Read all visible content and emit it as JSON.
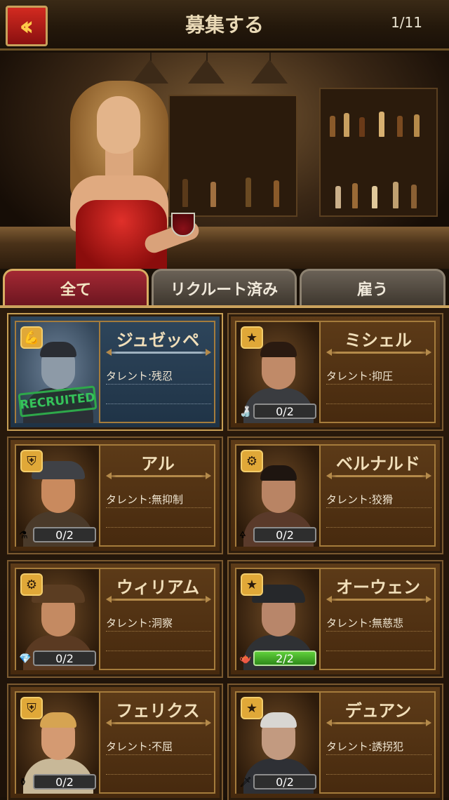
{
  "header": {
    "title": "募集する",
    "page_indicator": "1/11",
    "back_icon": "double-chevron-left-icon"
  },
  "tabs": [
    {
      "label": "全て",
      "active": true
    },
    {
      "label": "リクルート済み",
      "active": false
    },
    {
      "label": "雇う",
      "active": false
    }
  ],
  "characters": [
    {
      "name": "ジュゼッペ",
      "talent": "タレント:残忍",
      "recruited": true,
      "stamp": "RECRUITED",
      "badge_icon": "muscle-icon"
    },
    {
      "name": "ミシェル",
      "talent": "タレント:抑圧",
      "recruited": false,
      "count": "0/2",
      "badge_icon": "star-icon",
      "item_icon": "bottle-icon"
    },
    {
      "name": "アル",
      "talent": "タレント:無抑制",
      "recruited": false,
      "count": "0/2",
      "badge_icon": "shield-icon",
      "item_icon": "flask-icon"
    },
    {
      "name": "ベルナルド",
      "talent": "タレント:狡猾",
      "recruited": false,
      "count": "0/2",
      "badge_icon": "gear-icon",
      "item_icon": "pipe-icon"
    },
    {
      "name": "ウィリアム",
      "talent": "タレント:洞察",
      "recruited": false,
      "count": "0/2",
      "badge_icon": "gear-icon",
      "item_icon": "gem-icon"
    },
    {
      "name": "オーウェン",
      "talent": "タレント:無慈悲",
      "recruited": false,
      "count": "2/2",
      "badge_icon": "star-icon",
      "item_icon": "teapot-icon"
    },
    {
      "name": "フェリクス",
      "talent": "タレント:不屈",
      "recruited": false,
      "count": "0/2",
      "badge_icon": "shield-icon",
      "item_icon": "vase-icon"
    },
    {
      "name": "デュアン",
      "talent": "タレント:誘拐犯",
      "recruited": false,
      "count": "0/2",
      "badge_icon": "star-icon",
      "item_icon": "knife-icon"
    }
  ],
  "colors": {
    "accent_gold": "#c79f55",
    "tab_active": "#a32833",
    "count_full": "#4caf30"
  }
}
